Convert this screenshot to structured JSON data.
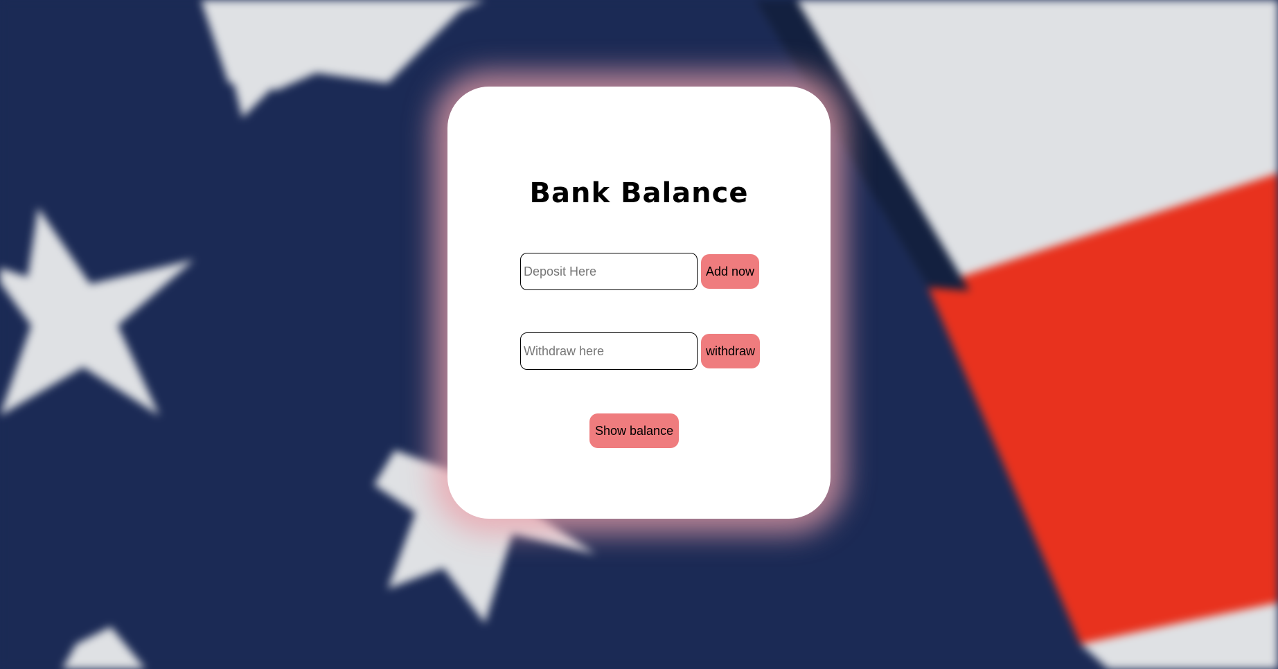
{
  "app": {
    "title": "Bank Balance"
  },
  "deposit": {
    "placeholder": "Deposit Here",
    "value": "",
    "button_label": "Add now"
  },
  "withdraw": {
    "placeholder": "Withdraw here",
    "value": "",
    "button_label": "withdraw"
  },
  "show_balance": {
    "button_label": "Show balance"
  },
  "colors": {
    "accent": "#ef7c7e",
    "card": "#ffffff",
    "flag_blue": "#1b2a55",
    "flag_red": "#e8321e",
    "flag_white": "#dfe1e4"
  }
}
